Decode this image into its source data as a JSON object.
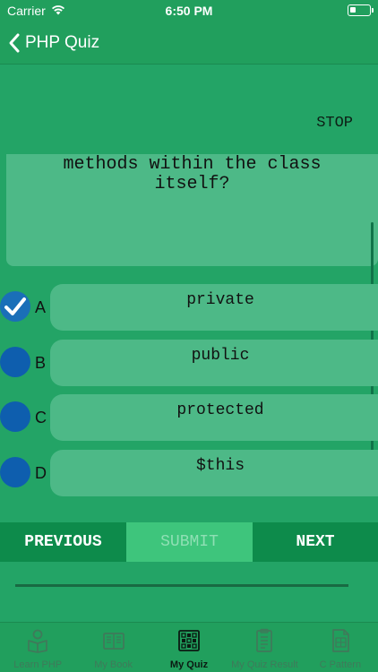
{
  "status_bar": {
    "carrier": "Carrier",
    "time": "6:50 PM"
  },
  "nav": {
    "title": "PHP Quiz"
  },
  "quiz": {
    "stop_label": "STOP",
    "question_text": "refer to properties or\nmethods within the class\nitself?",
    "options": [
      {
        "letter": "A",
        "text": "private",
        "selected": true
      },
      {
        "letter": "B",
        "text": "public",
        "selected": false
      },
      {
        "letter": "C",
        "text": "protected",
        "selected": false
      },
      {
        "letter": "D",
        "text": "$this",
        "selected": false
      }
    ]
  },
  "buttons": {
    "previous": "PREVIOUS",
    "submit": "SUBMIT",
    "next": "NEXT"
  },
  "tabs": [
    {
      "label": "Learn PHP",
      "icon": "reader-icon",
      "active": false
    },
    {
      "label": "My Book",
      "icon": "book-icon",
      "active": false
    },
    {
      "label": "My Quiz",
      "icon": "quiz-icon",
      "active": true
    },
    {
      "label": "My Quiz Result",
      "icon": "result-icon",
      "active": false
    },
    {
      "label": "C Pattern",
      "icon": "pattern-icon",
      "active": false
    }
  ],
  "colors": {
    "primary": "#23a466",
    "card": "#4db987",
    "button_dark": "#0d8b4b",
    "radio": "#0e5eae"
  }
}
